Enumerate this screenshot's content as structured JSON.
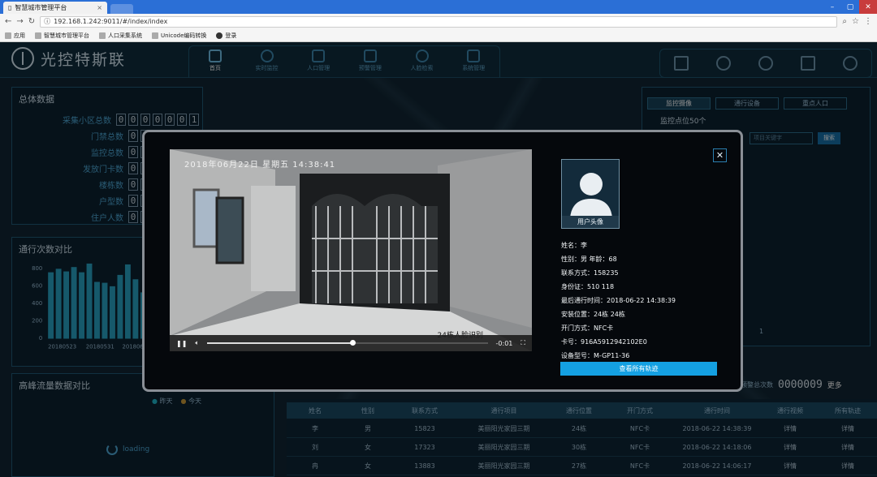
{
  "browser": {
    "tab_title": "智慧城市管理平台",
    "url": "192.168.1.242:9011/#/index/index",
    "bookmarks": [
      "应用",
      "智慧城市管理平台",
      "人口采集系统",
      "Unicode编码转换",
      "登录"
    ]
  },
  "app": {
    "logo": "光控特斯联",
    "nav": [
      {
        "label": "首页",
        "icon": "monitor-icon",
        "active": true
      },
      {
        "label": "实时监控",
        "icon": "camera-icon"
      },
      {
        "label": "人口管理",
        "icon": "people-icon"
      },
      {
        "label": "预警管理",
        "icon": "warning-icon"
      },
      {
        "label": "人脸检索",
        "icon": "face-icon"
      },
      {
        "label": "系统管理",
        "icon": "gears-icon"
      }
    ]
  },
  "overview": {
    "title": "总体数据",
    "stats": [
      {
        "label": "采集小区总数",
        "digits": "0000001"
      },
      {
        "label": "门禁总数",
        "digits": "000000"
      },
      {
        "label": "监控总数",
        "digits": "000000"
      },
      {
        "label": "发放门卡数",
        "digits": "000000"
      },
      {
        "label": "楼栋数",
        "digits": "000000"
      },
      {
        "label": "户型数",
        "digits": "000000"
      },
      {
        "label": "住户人数",
        "digits": "000000"
      }
    ]
  },
  "pass_chart": {
    "title": "通行次数对比",
    "y_ticks": [
      "800",
      "600",
      "400",
      "200",
      "0"
    ],
    "x_ticks": [
      "20180523",
      "20180531",
      "20180608"
    ]
  },
  "chart_data": {
    "type": "bar",
    "title": "通行次数对比",
    "ylim": [
      0,
      900
    ],
    "categories": [
      "20180523",
      "",
      "",
      "",
      "",
      "",
      "",
      "",
      "20180531",
      "",
      "",
      "",
      "",
      "",
      "",
      "",
      "20180608"
    ],
    "values": [
      760,
      800,
      770,
      820,
      760,
      860,
      650,
      640,
      600,
      730,
      850,
      680,
      530,
      350,
      280,
      300,
      200
    ]
  },
  "peak": {
    "title": "高峰流量数据对比",
    "legend": [
      {
        "label": "昨天",
        "color": "#1fb5c8"
      },
      {
        "label": "今天",
        "color": "#c89a3a"
      }
    ],
    "loading": "loading"
  },
  "right": {
    "tabs": [
      "监控摄像",
      "通行设备",
      "重点人口"
    ],
    "count_title": "监控点位50个",
    "search_placeholder": "项目关键字",
    "search_btn": "搜索",
    "page": "1"
  },
  "alarm": {
    "label": "预警总次数",
    "digits": "0000009",
    "more": "更多"
  },
  "table": {
    "headers": [
      "姓名",
      "性别",
      "联系方式",
      "通行项目",
      "通行位置",
      "开门方式",
      "通行时间",
      "通行视频",
      "所有轨迹"
    ],
    "rows": [
      [
        "李",
        "男",
        "15823",
        "美丽阳光家园三期",
        "24栋",
        "NFC卡",
        "2018-06-22 14:38:39",
        "详情",
        "详情"
      ],
      [
        "刘",
        "女",
        "17323",
        "美丽阳光家园三期",
        "30栋",
        "NFC卡",
        "2018-06-22 14:18:06",
        "详情",
        "详情"
      ],
      [
        "冉",
        "女",
        "13883",
        "美丽阳光家园三期",
        "27栋",
        "NFC卡",
        "2018-06-22 14:06:17",
        "详情",
        "详情"
      ]
    ]
  },
  "modal": {
    "video_time": "2018年06月22日 星期五 14:38:41",
    "video_caption": "24栋人脸识别",
    "time_left": "-0:01",
    "progress": 0.52,
    "avatar_label": "用户头像",
    "info": [
      "姓名：李",
      "性别：男   年龄：68",
      "联系方式：158235",
      "身份证：510             118",
      "最后通行时间：2018-06-22 14:38:39",
      "安装位置：24栋 24栋",
      "开门方式：NFC卡",
      "卡号：916A5912942102E0",
      "设备型号：M-GP11-36"
    ],
    "track_btn": "查看所有轨迹",
    "close": "✕"
  }
}
